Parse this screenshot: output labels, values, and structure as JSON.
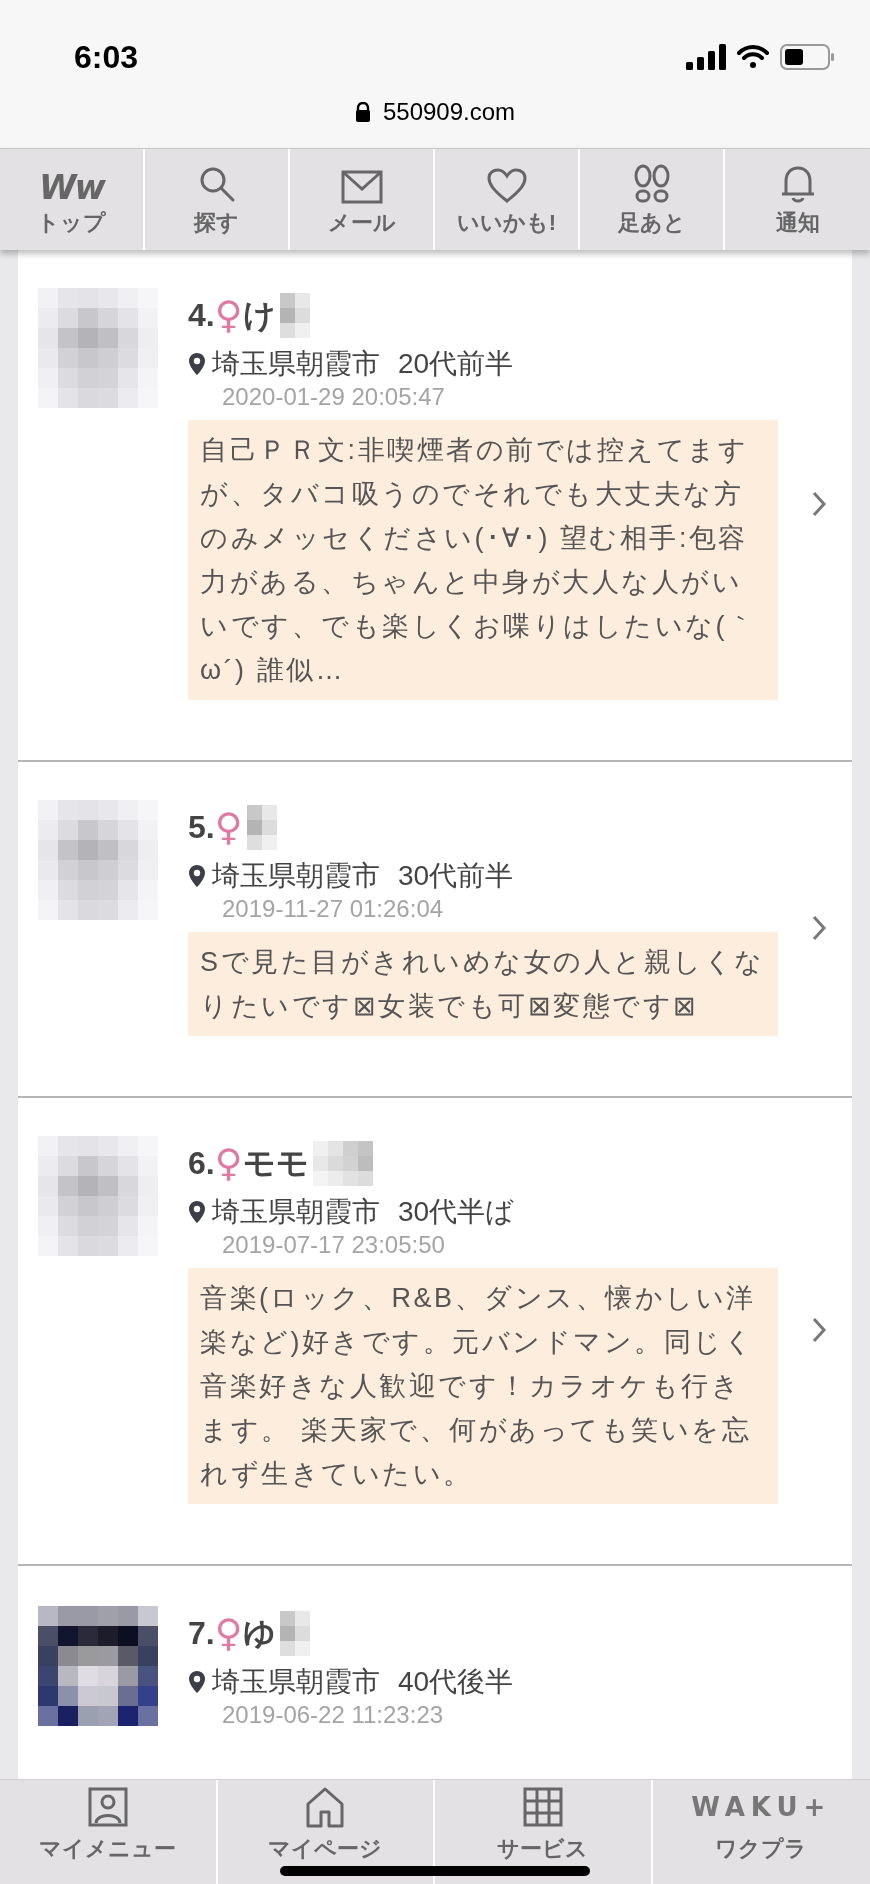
{
  "status_bar": {
    "time": "6:03"
  },
  "browser": {
    "url": "550909.com"
  },
  "top_nav": [
    {
      "label": "トップ",
      "logo": "Ww"
    },
    {
      "label": "探す"
    },
    {
      "label": "メール"
    },
    {
      "label": "いいかも!"
    },
    {
      "label": "足あと"
    },
    {
      "label": "通知"
    }
  ],
  "profiles": [
    {
      "rank": "4.",
      "gender": "♀",
      "name": "け",
      "location": "埼玉県朝霞市",
      "age": "20代前半",
      "date": "2020-01-29 20:05:47",
      "bio": "自己ＰＲ文:非喫煙者の前では控えてますが、タバコ吸うのでそれでも大丈夫な方のみメッセください(･∀･) 望む相手:包容力がある、ちゃんと中身が大人な人がいいです、でも楽しくお喋りはしたいな(｀ω´) 誰似…"
    },
    {
      "rank": "5.",
      "gender": "♀",
      "location": "埼玉県朝霞市",
      "age": "30代前半",
      "date": "2019-11-27 01:26:04",
      "bio": "Sで見た目がきれいめな女の人と親しくなりたいです⊠女装でも可⊠変態です⊠"
    },
    {
      "rank": "6.",
      "gender": "♀",
      "name": "モモ",
      "location": "埼玉県朝霞市",
      "age": "30代半ば",
      "date": "2019-07-17 23:05:50",
      "bio": "音楽(ロック、R&B、ダンス、懐かしい洋楽など)好きです。元バンドマン。同じく音楽好きな人歓迎です！カラオケも行きます。 楽天家で、何があっても笑いを忘れず生きていたい。"
    },
    {
      "rank": "7.",
      "gender": "♀",
      "name": "ゆ",
      "location": "埼玉県朝霞市",
      "age": "40代後半",
      "date": "2019-06-22 11:23:23"
    }
  ],
  "bottom_nav": [
    {
      "label": "マイメニュー"
    },
    {
      "label": "マイページ"
    },
    {
      "label": "サービス"
    },
    {
      "label": "ワクプラ",
      "logo": "WAKU+"
    }
  ]
}
